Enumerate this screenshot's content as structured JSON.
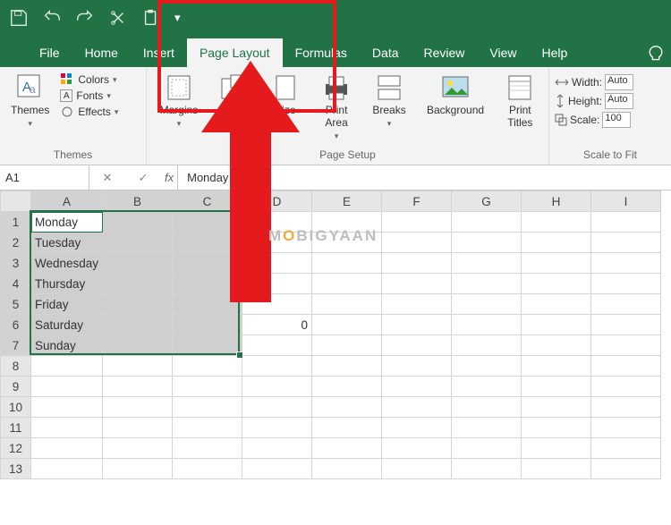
{
  "qat": {
    "icons": [
      "save",
      "undo",
      "redo",
      "cut",
      "paste",
      "more"
    ]
  },
  "tabs": {
    "items": [
      "File",
      "Home",
      "Insert",
      "Page Layout",
      "Formulas",
      "Data",
      "Review",
      "View",
      "Help"
    ],
    "active": "Page Layout"
  },
  "ribbon": {
    "themes": {
      "main": "Themes",
      "colors": "Colors",
      "fonts": "Fonts",
      "effects": "Effects",
      "group": "Themes"
    },
    "pagesetup": {
      "margins": "Margins",
      "orientation": "Orientation",
      "size": "Size",
      "printarea": "Print\nArea",
      "breaks": "Breaks",
      "background": "Background",
      "printtitles": "Print\nTitles",
      "group": "Page Setup"
    },
    "scale": {
      "width_label": "Width:",
      "width_value": "Auto",
      "height_label": "Height:",
      "height_value": "Auto",
      "scale_label": "Scale:",
      "scale_value": "100",
      "group": "Scale to Fit"
    }
  },
  "namebox": "A1",
  "formula": "Monday",
  "watermark": {
    "a": "M",
    "b": "O",
    "c": "BIGYAAN"
  },
  "columns": [
    "A",
    "B",
    "C",
    "D",
    "E",
    "F",
    "G",
    "H",
    "I"
  ],
  "rows": [
    "1",
    "2",
    "3",
    "4",
    "5",
    "6",
    "7",
    "8",
    "9",
    "10",
    "11",
    "12",
    "13"
  ],
  "cells": {
    "A1": "Monday",
    "A2": "Tuesday",
    "A3": "Wednesday",
    "A4": "Thursday",
    "A5": "Friday",
    "A6": "Saturday",
    "A7": "Sunday",
    "D6": "0"
  },
  "selection": {
    "r1": 1,
    "c1": 1,
    "r2": 7,
    "c2": 3
  }
}
